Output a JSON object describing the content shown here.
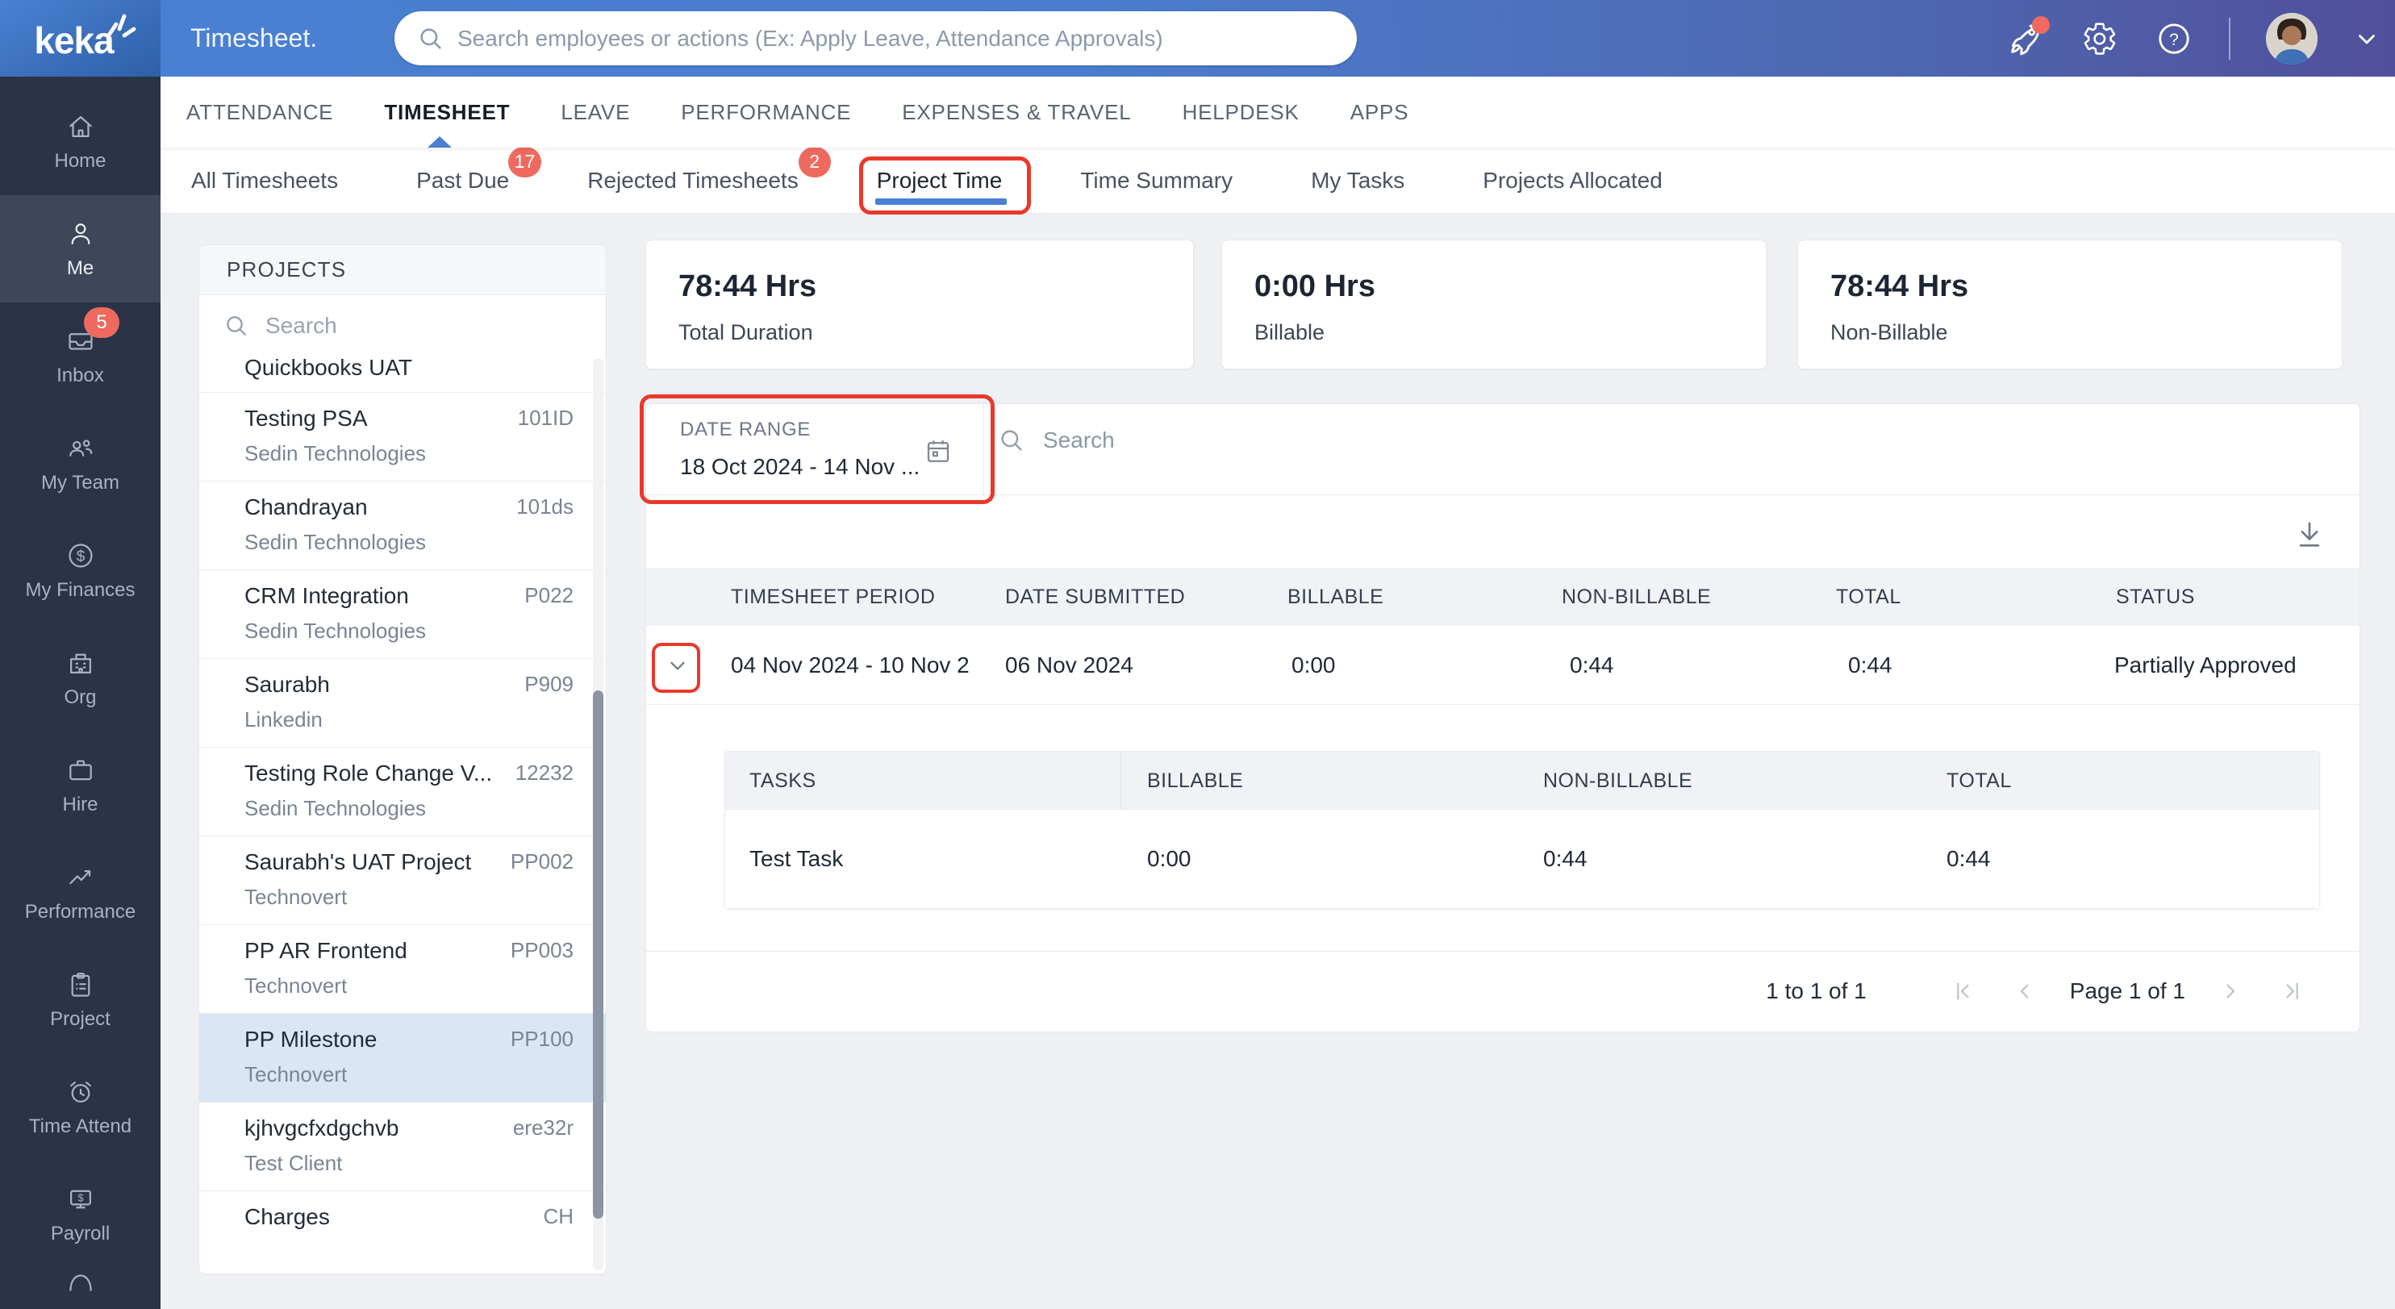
{
  "colors": {
    "accent_blue": "#4a7fd4",
    "topbar_gradient_left": "#4a80d2",
    "topbar_gradient_right": "#514f9b",
    "sidebar_bg": "#2b3347",
    "badge_red": "#ee6a5f",
    "annotation_red": "#e8392b",
    "selected_project_bg": "#d9e6f6"
  },
  "icons": {
    "logo_spark": "spark-strokes",
    "search": "magnifier",
    "announcements": "rocket",
    "settings": "gear",
    "help": "question-circle",
    "profile_caret": "chevron-down",
    "calendar": "calendar",
    "download": "down-arrow-underline",
    "row_expand": "chevron-down"
  },
  "topbar": {
    "logo_text": "keka",
    "page_title": "Timesheet.",
    "search_placeholder": "Search employees or actions (Ex: Apply Leave, Attendance Approvals)"
  },
  "sidebar": {
    "items": [
      {
        "label": "Home"
      },
      {
        "label": "Me"
      },
      {
        "label": "Inbox",
        "badge": "5"
      },
      {
        "label": "My Team"
      },
      {
        "label": "My Finances"
      },
      {
        "label": "Org"
      },
      {
        "label": "Hire"
      },
      {
        "label": "Performance"
      },
      {
        "label": "Project"
      },
      {
        "label": "Time Attend"
      },
      {
        "label": "Payroll"
      }
    ],
    "active_item": "Me"
  },
  "main_nav": {
    "items": [
      {
        "label": "ATTENDANCE"
      },
      {
        "label": "TIMESHEET"
      },
      {
        "label": "LEAVE"
      },
      {
        "label": "PERFORMANCE"
      },
      {
        "label": "EXPENSES & TRAVEL"
      },
      {
        "label": "HELPDESK"
      },
      {
        "label": "APPS"
      }
    ],
    "active_item": "TIMESHEET"
  },
  "sub_nav": {
    "items": [
      {
        "label": "All Timesheets"
      },
      {
        "label": "Past Due",
        "badge": "17"
      },
      {
        "label": "Rejected Timesheets",
        "badge": "2"
      },
      {
        "label": "Project Time"
      },
      {
        "label": "Time Summary"
      },
      {
        "label": "My Tasks"
      },
      {
        "label": "Projects Allocated"
      }
    ],
    "active_item": "Project Time"
  },
  "projects_panel": {
    "title": "PROJECTS",
    "search_placeholder": "Search",
    "scrolled_partial_item": "Quickbooks UAT",
    "selected_item": "PP Milestone",
    "items": [
      {
        "name": "Testing PSA",
        "client": "Sedin Technologies",
        "code": "101ID"
      },
      {
        "name": "Chandrayan",
        "client": "Sedin Technologies",
        "code": "101ds"
      },
      {
        "name": "CRM Integration",
        "client": "Sedin Technologies",
        "code": "P022"
      },
      {
        "name": "Saurabh",
        "client": "Linkedin",
        "code": "P909"
      },
      {
        "name": "Testing Role Change V...",
        "client": "Sedin Technologies",
        "code": "12232"
      },
      {
        "name": "Saurabh's UAT Project",
        "client": "Technovert",
        "code": "PP002"
      },
      {
        "name": "PP AR Frontend",
        "client": "Technovert",
        "code": "PP003"
      },
      {
        "name": "PP Milestone",
        "client": "Technovert",
        "code": "PP100"
      },
      {
        "name": "kjhvgcfxdgchvb",
        "client": "Test Client",
        "code": "ere32r"
      },
      {
        "name": "Charges",
        "code": "CH"
      }
    ]
  },
  "stats_cards": [
    {
      "value": "78:44 Hrs",
      "label": "Total Duration"
    },
    {
      "value": "0:00 Hrs",
      "label": "Billable"
    },
    {
      "value": "78:44 Hrs",
      "label": "Non-Billable"
    }
  ],
  "filters": {
    "date_range_label": "DATE RANGE",
    "date_range_value": "18 Oct 2024 - 14 Nov ...",
    "search_placeholder": "Search"
  },
  "timesheet_table": {
    "columns": [
      "TIMESHEET PERIOD",
      "DATE SUBMITTED",
      "BILLABLE",
      "NON-BILLABLE",
      "TOTAL",
      "STATUS"
    ],
    "rows": [
      {
        "period": "04 Nov 2024 - 10 Nov 2",
        "date_submitted": "06 Nov 2024",
        "billable": "0:00",
        "non_billable": "0:44",
        "total": "0:44",
        "status": "Partially Approved"
      }
    ]
  },
  "tasks_table": {
    "columns": [
      "TASKS",
      "BILLABLE",
      "NON-BILLABLE",
      "TOTAL"
    ],
    "rows": [
      {
        "task": "Test Task",
        "billable": "0:00",
        "non_billable": "0:44",
        "total": "0:44"
      }
    ]
  },
  "pagination": {
    "range_text": "1 to 1 of 1",
    "page_text": "Page 1 of 1"
  }
}
